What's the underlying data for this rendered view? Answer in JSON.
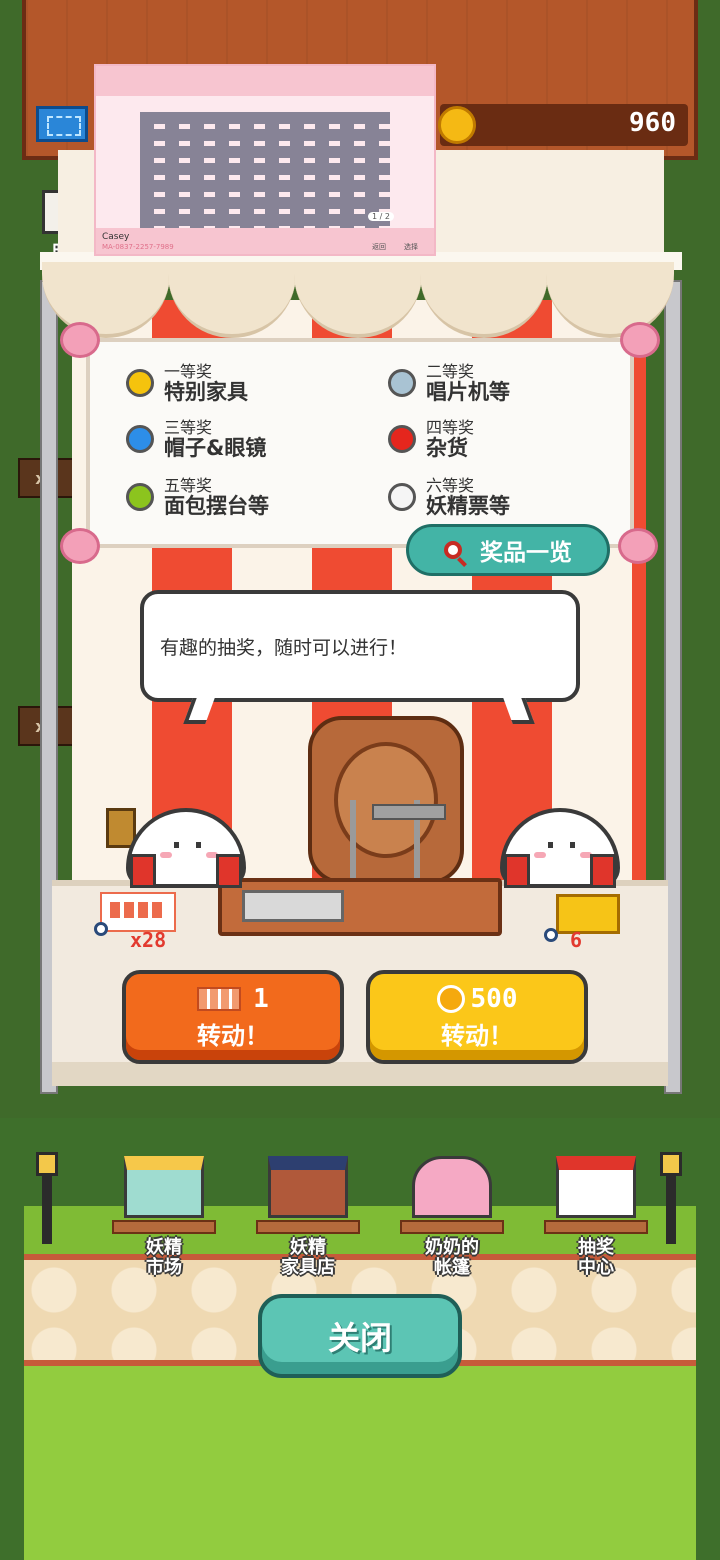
{
  "header": {
    "coins": "960",
    "camera_label": "照相"
  },
  "preview": {
    "name": "Casey",
    "code": "MA-0837-2257-7989",
    "page": "1 / 2",
    "back": "返回",
    "select": "选择"
  },
  "prizes": [
    {
      "rank": "一等奖",
      "item": "特别家具",
      "color": "#f5c30d"
    },
    {
      "rank": "二等奖",
      "item": "唱片机等",
      "color": "#a9c3d3"
    },
    {
      "rank": "三等奖",
      "item": "帽子&眼镜",
      "color": "#2d8ee8"
    },
    {
      "rank": "四等奖",
      "item": "杂货",
      "color": "#e5261d"
    },
    {
      "rank": "五等奖",
      "item": "面包摆台等",
      "color": "#8cc41e"
    },
    {
      "rank": "六等奖",
      "item": "妖精票等",
      "color": "#f5f5f5"
    }
  ],
  "prize_list_button": "奖品一览",
  "speech": "有趣的抽奖，随时可以进行！",
  "counters": {
    "tickets": "x28",
    "golden_tickets": "6"
  },
  "spin": {
    "ticket_cost": "1",
    "ticket_label": "转动！",
    "coin_cost": "500",
    "coin_label": "转动！"
  },
  "side_signs": [
    "x8",
    "x8"
  ],
  "nav": [
    {
      "label1": "妖精",
      "label2": "市场"
    },
    {
      "label1": "妖精",
      "label2": "家具店"
    },
    {
      "label1": "奶奶的",
      "label2": "帐篷"
    },
    {
      "label1": "抽奖",
      "label2": "中心"
    }
  ],
  "close_button": "关闭"
}
